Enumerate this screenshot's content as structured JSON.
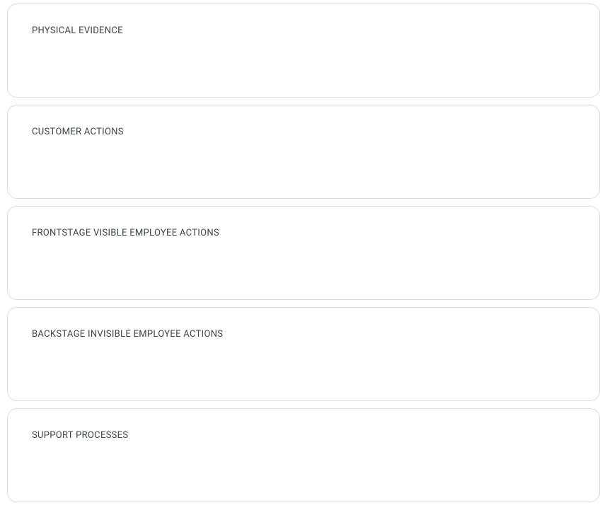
{
  "lanes": [
    {
      "title": "PHYSICAL EVIDENCE"
    },
    {
      "title": "CUSTOMER ACTIONS"
    },
    {
      "title": "FRONTSTAGE VISIBLE EMPLOYEE ACTIONS"
    },
    {
      "title": "BACKSTAGE INVISIBLE EMPLOYEE ACTIONS"
    },
    {
      "title": "SUPPORT PROCESSES"
    }
  ]
}
